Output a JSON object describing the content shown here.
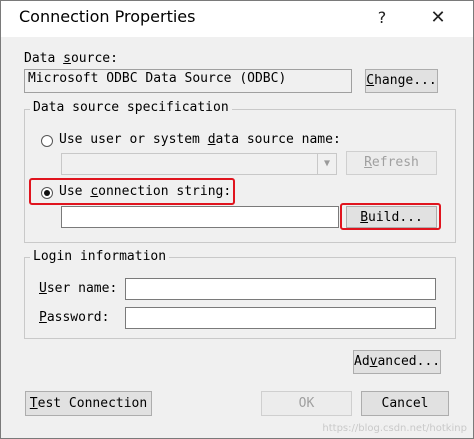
{
  "window": {
    "title": "Connection Properties",
    "help_glyph": "?",
    "close_glyph": "✕"
  },
  "data_source": {
    "label": "Data source:",
    "value": "Microsoft ODBC Data Source (ODBC)",
    "change_button": "Change..."
  },
  "spec": {
    "group_label": "Data source specification",
    "option_dsn": "Use user or system data source name:",
    "refresh_button": "Refresh",
    "option_conn_string": "Use connection string:",
    "conn_string_value": "",
    "build_button": "Build..."
  },
  "login": {
    "group_label": "Login information",
    "user_label": "User name:",
    "user_value": "",
    "password_label": "Password:",
    "password_value": ""
  },
  "buttons": {
    "advanced": "Advanced...",
    "test_connection": "Test Connection",
    "ok": "OK",
    "cancel": "Cancel"
  },
  "watermark": "https://blog.csdn.net/hotkinp",
  "colors": {
    "highlight": "#e0141e",
    "dialog_bg": "#f0f0f0"
  }
}
